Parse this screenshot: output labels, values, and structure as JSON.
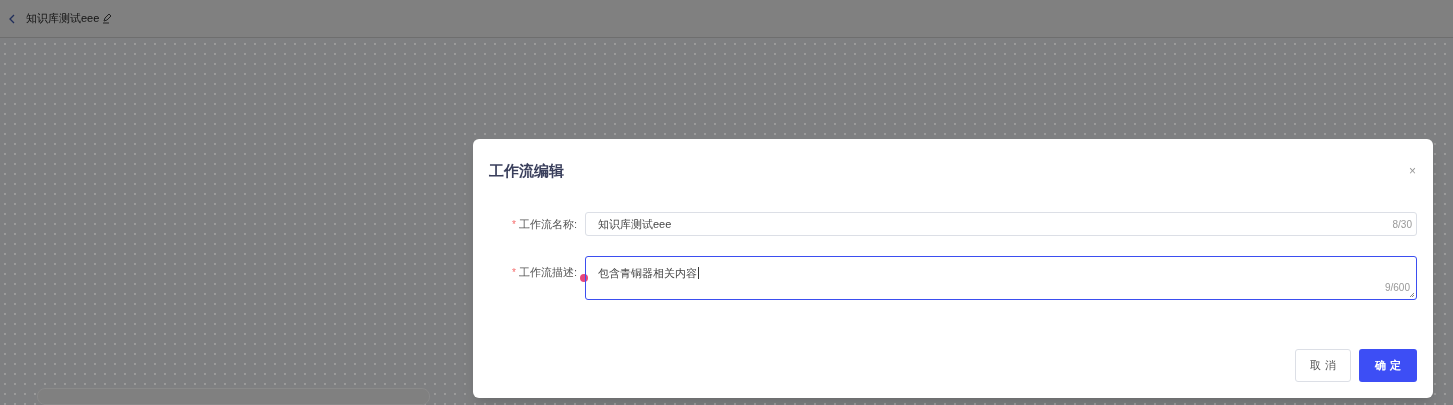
{
  "header": {
    "title": "知识库测试eee"
  },
  "dialog": {
    "title": "工作流编辑",
    "close": "×",
    "fields": [
      {
        "kind": "input",
        "required_mark": "*",
        "label": "工作流名称:",
        "value": "知识库测试eee",
        "counter": "8/30",
        "focused": false
      },
      {
        "kind": "textarea",
        "required_mark": "*",
        "label": "工作流描述:",
        "value": "包含青铜器相关内容",
        "counter": "9/600",
        "focused": true
      }
    ],
    "buttons": [
      {
        "label": "取 消",
        "kind": "secondary"
      },
      {
        "label": "确 定",
        "kind": "primary"
      }
    ]
  }
}
